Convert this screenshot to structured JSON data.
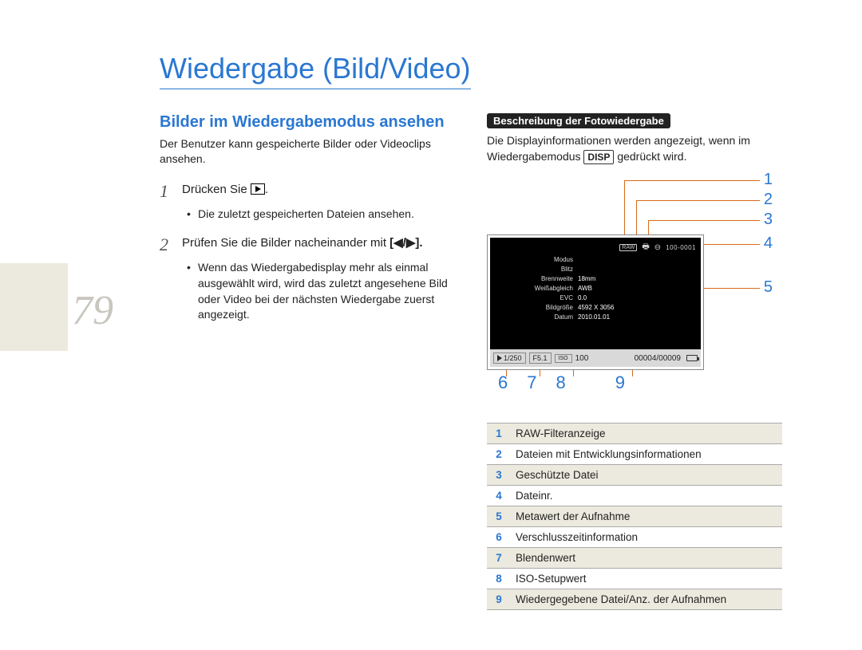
{
  "page_number": "79",
  "title": "Wiedergabe (Bild/Video)",
  "subhead": "Bilder im Wiedergabemodus ansehen",
  "intro": "Der Benutzer kann gespeicherte Bilder oder Videoclips ansehen.",
  "steps": [
    {
      "num": "1",
      "text": "Drücken Sie ",
      "bullets": [
        "Die zuletzt gespeicherten Dateien ansehen."
      ]
    },
    {
      "num": "2",
      "text_before": "Prüfen Sie die Bilder nacheinander mit ",
      "keys": "[◀/▶].",
      "bullets": [
        "Wenn das Wiedergabedisplay mehr als einmal ausgewählt wird, wird das zuletzt angesehene Bild oder Video bei der nächsten Wiedergabe zuerst angezeigt."
      ]
    }
  ],
  "right": {
    "pill": "Beschreibung der Fotowiedergabe",
    "desc_before": "Die Displayinformationen werden angezeigt, wenn im Wiedergabemodus ",
    "disp": "DISP",
    "desc_after": " gedrückt wird.",
    "callouts_right": [
      "1",
      "2",
      "3",
      "4",
      "5"
    ],
    "callouts_bottom": [
      "6",
      "7",
      "8",
      "9"
    ],
    "screen": {
      "raw": "RAW",
      "file_no": "100-0001",
      "meta": [
        {
          "label": "Modus",
          "value": ""
        },
        {
          "label": "Blitz",
          "value": ""
        },
        {
          "label": "Brennweite",
          "value": "18mm"
        },
        {
          "label": "Weißabgleich",
          "value": "AWB"
        },
        {
          "label": "EVC",
          "value": "0.0"
        },
        {
          "label": "Bildgröße",
          "value": "4592 X 3056"
        },
        {
          "label": "Datum",
          "value": "2010.01.01"
        }
      ],
      "strip": {
        "shutter": "1/250",
        "aperture": "F5.1",
        "iso_label": "ISO",
        "iso": "100",
        "count": "00004/00009"
      }
    },
    "legend": [
      {
        "n": "1",
        "t": "RAW-Filteranzeige"
      },
      {
        "n": "2",
        "t": "Dateien mit Entwicklungsinformationen"
      },
      {
        "n": "3",
        "t": "Geschützte Datei"
      },
      {
        "n": "4",
        "t": "Dateinr."
      },
      {
        "n": "5",
        "t": "Metawert der Aufnahme"
      },
      {
        "n": "6",
        "t": "Verschlusszeitinformation"
      },
      {
        "n": "7",
        "t": "Blendenwert"
      },
      {
        "n": "8",
        "t": "ISO-Setupwert"
      },
      {
        "n": "9",
        "t": "Wiedergegebene Datei/Anz. der Aufnahmen"
      }
    ]
  }
}
